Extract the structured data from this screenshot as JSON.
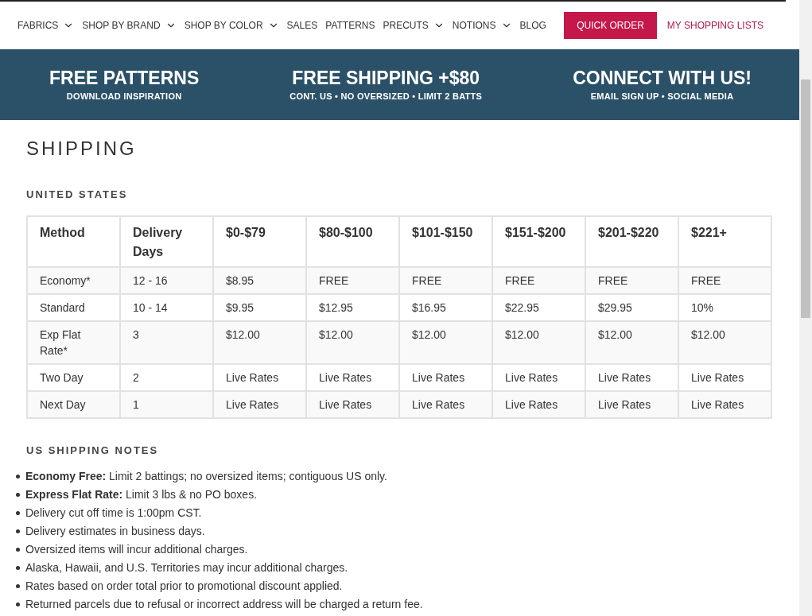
{
  "nav": {
    "items": [
      {
        "label": "FABRICS",
        "dropdown": true
      },
      {
        "label": "SHOP BY BRAND",
        "dropdown": true
      },
      {
        "label": "SHOP BY COLOR",
        "dropdown": true
      },
      {
        "label": "SALES",
        "dropdown": false
      },
      {
        "label": "PATTERNS",
        "dropdown": false
      },
      {
        "label": "PRECUTS",
        "dropdown": true
      },
      {
        "label": "NOTIONS",
        "dropdown": true
      },
      {
        "label": "BLOG",
        "dropdown": false
      }
    ],
    "quick_order": "QUICK ORDER",
    "shopping_lists": "MY SHOPPING LISTS"
  },
  "banner": [
    {
      "title": "FREE PATTERNS",
      "subtitle": "DOWNLOAD INSPIRATION"
    },
    {
      "title": "FREE SHIPPING +$80",
      "subtitle": "CONT. US • NO OVERSIZED • LIMIT 2 BATTS"
    },
    {
      "title": "CONNECT WITH US!",
      "subtitle": "EMAIL SIGN UP • SOCIAL MEDIA"
    }
  ],
  "page_title": "SHIPPING",
  "section_title": "UNITED STATES",
  "table": {
    "columns": [
      "Method",
      "Delivery Days",
      "$0-$79",
      "$80-$100",
      "$101-$150",
      "$151-$200",
      "$201-$220",
      "$221+"
    ],
    "rows": [
      [
        "Economy*",
        "12 - 16",
        "$8.95",
        "FREE",
        "FREE",
        "FREE",
        "FREE",
        "FREE"
      ],
      [
        "Standard",
        "10 - 14",
        "$9.95",
        "$12.95",
        "$16.95",
        "$22.95",
        "$29.95",
        "10%"
      ],
      [
        "Exp Flat Rate*",
        "3",
        "$12.00",
        "$12.00",
        "$12.00",
        "$12.00",
        "$12.00",
        "$12.00"
      ],
      [
        "Two Day",
        "2",
        "Live Rates",
        "Live Rates",
        "Live Rates",
        "Live Rates",
        "Live Rates",
        "Live Rates"
      ],
      [
        "Next Day",
        "1",
        "Live Rates",
        "Live Rates",
        "Live Rates",
        "Live Rates",
        "Live Rates",
        "Live Rates"
      ]
    ]
  },
  "notes_title": "US SHIPPING NOTES",
  "notes": [
    "**Economy Free:** Limit 2 battings; no oversized items; contiguous US only.",
    "**Express Flat Rate:** Limit 3 lbs & no PO boxes.",
    "Delivery cut off time is 1:00pm CST.",
    "Delivery estimates in business days.",
    "Oversized items will incur additional charges.",
    "Alaska, Hawaii, and U.S. Territories may incur additional charges.",
    "Rates based on order total prior to promotional discount applied.",
    "Returned parcels due to refusal or incorrect address will be charged a return fee."
  ]
}
